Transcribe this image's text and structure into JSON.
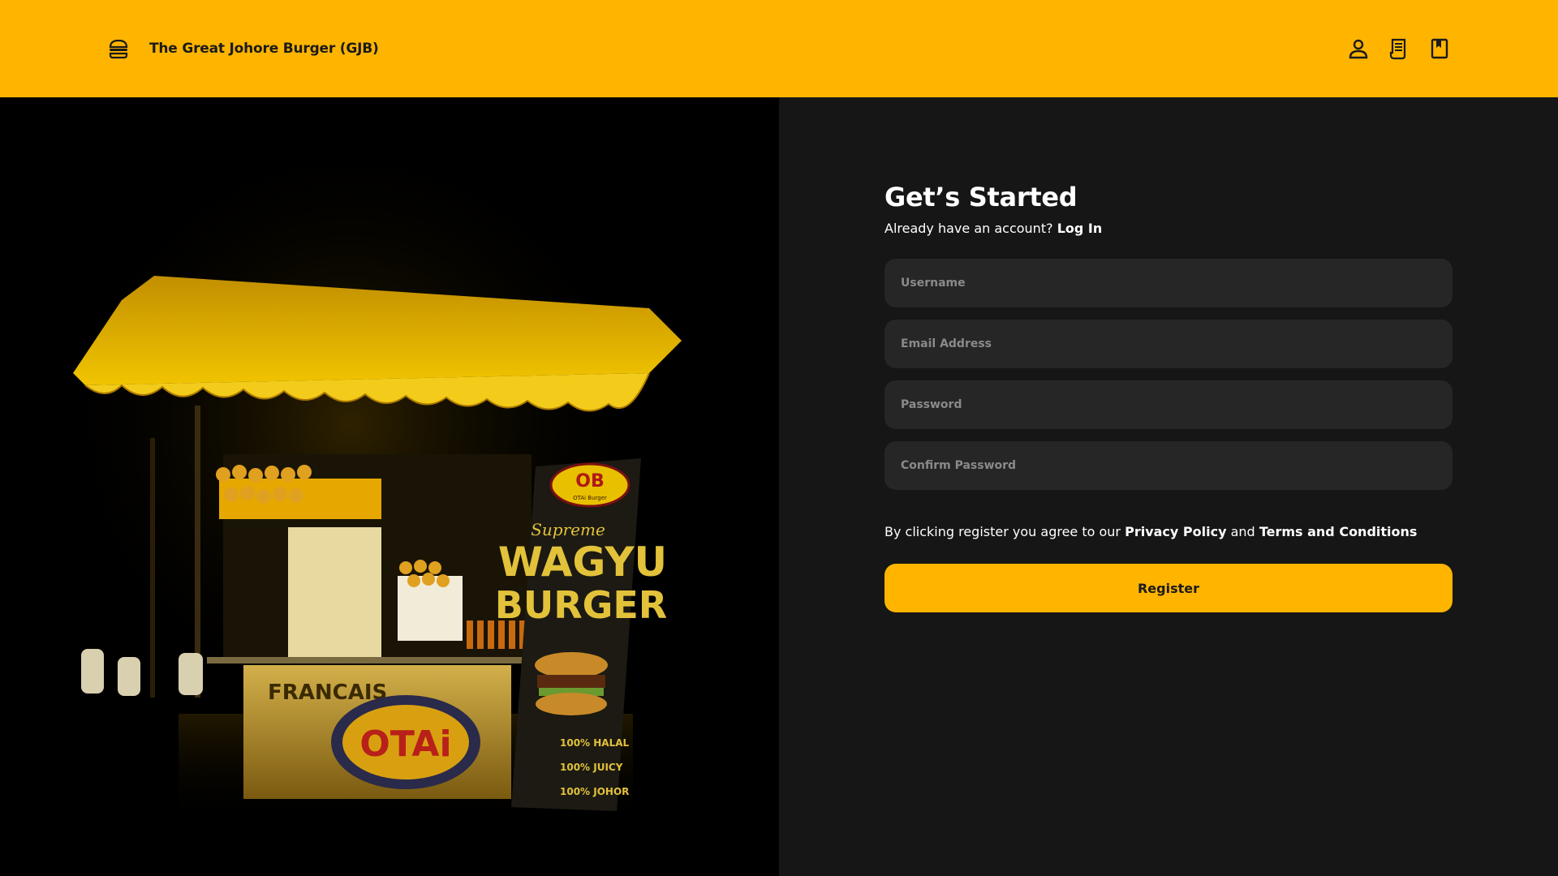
{
  "header": {
    "brand_icon": "burger-icon",
    "title": "The Great Johore Burger (GJB)",
    "nav_icons": [
      "user-icon",
      "receipt-icon",
      "bookmark-icon"
    ],
    "accent_color": "#FFB400"
  },
  "hero": {
    "image": "burger-stall-photo",
    "sign_brand": "OB",
    "sign_sub": "OTAi Burger",
    "sign_line1": "Supreme",
    "sign_line2": "WAGYU",
    "sign_line3": "BURGER",
    "sign_badges": [
      "100% HALAL",
      "100% JUICY",
      "100% JOHOR"
    ],
    "cart_brand": "OTAi",
    "cart_text": "FRANCAIS"
  },
  "form": {
    "heading": "Get’s Started",
    "subline_text": "Already have an account?",
    "login_link": "Log In",
    "fields": {
      "username_placeholder": "Username",
      "email_placeholder": "Email Address",
      "password_placeholder": "Password",
      "confirm_placeholder": "Confirm Password"
    },
    "terms_prefix": "By clicking register you agree to our",
    "privacy_link": "Privacy Policy",
    "terms_and": "and",
    "terms_link": "Terms and Conditions",
    "register_label": "Register"
  }
}
